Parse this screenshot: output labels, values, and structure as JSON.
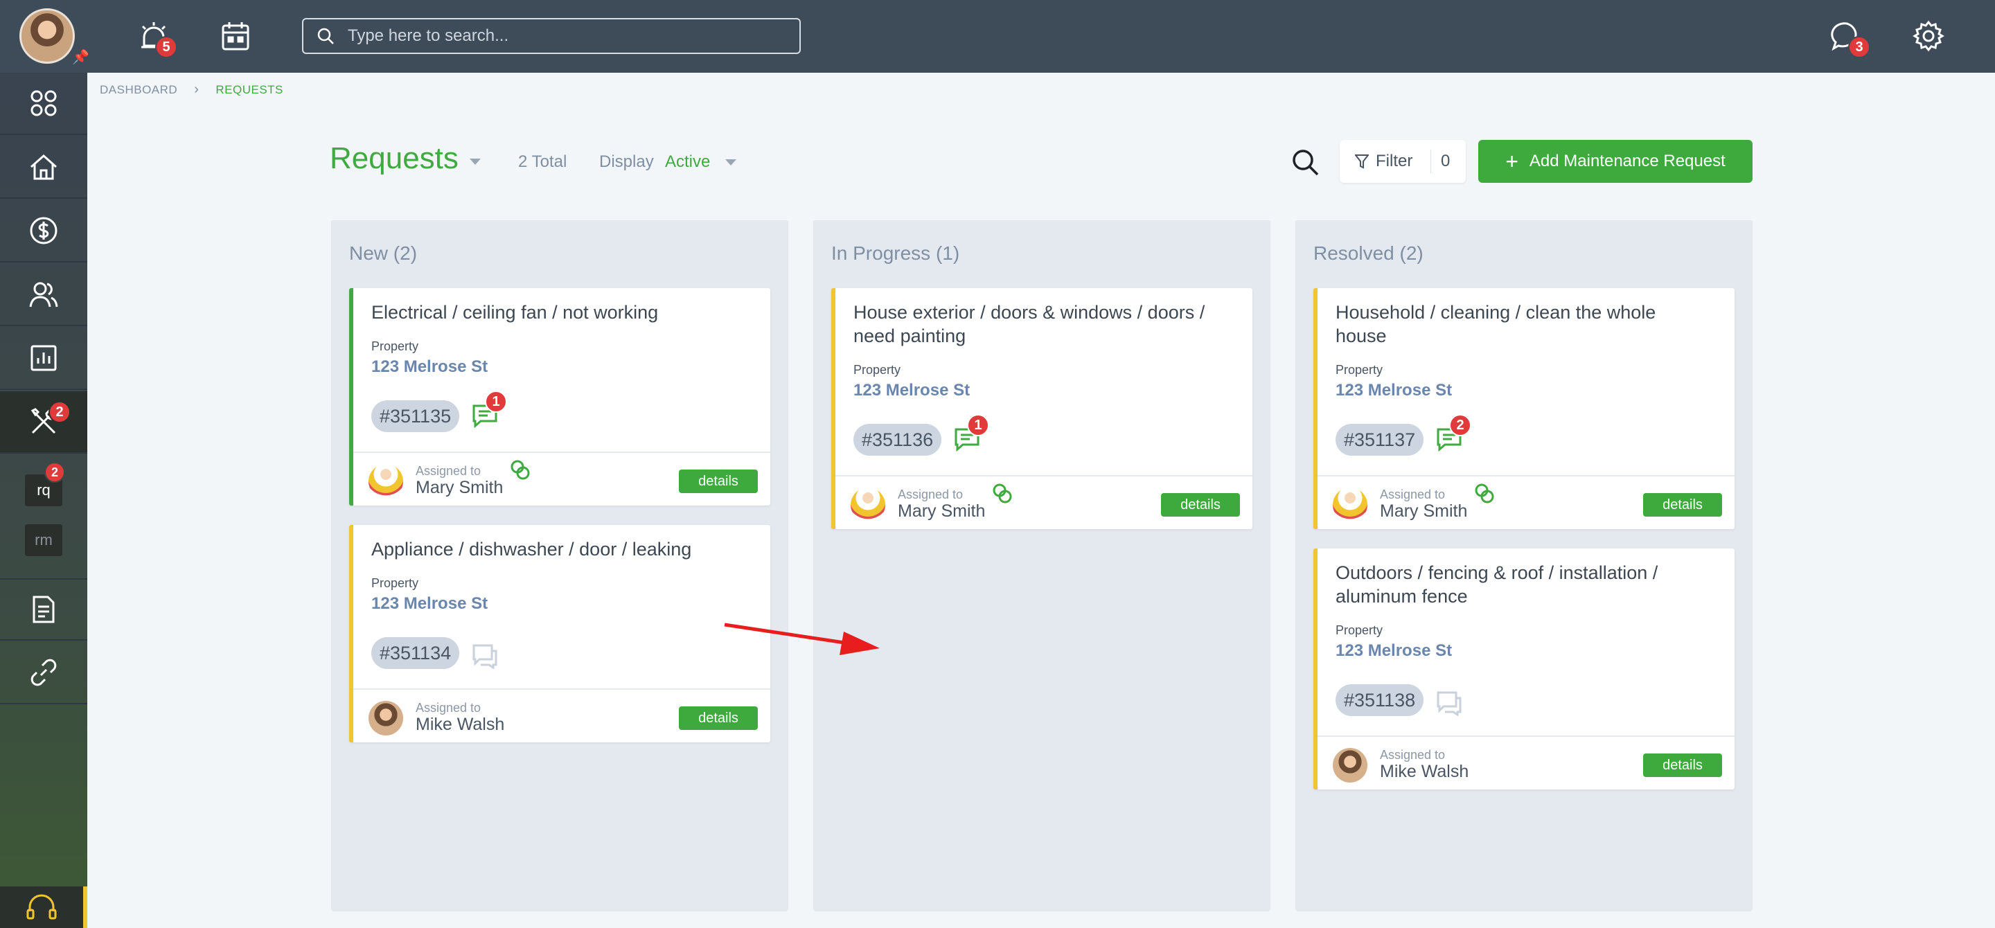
{
  "topbar": {
    "notifications_badge": "5",
    "search_placeholder": "Type here to search...",
    "messages_badge": "3"
  },
  "sidebar": {
    "items": [
      {
        "icon": "grid-icon"
      },
      {
        "icon": "home-icon"
      },
      {
        "icon": "dollar-icon"
      },
      {
        "icon": "users-icon"
      },
      {
        "icon": "chart-icon"
      },
      {
        "icon": "tools-icon",
        "badge": "2"
      },
      {
        "icon": "document-icon"
      },
      {
        "icon": "link-icon"
      }
    ],
    "sub_items": [
      {
        "label": "rq",
        "badge": "2"
      },
      {
        "label": "rm"
      }
    ],
    "help_icon": "headset-icon"
  },
  "breadcrumb": {
    "items": [
      "DASHBOARD",
      "REQUESTS"
    ]
  },
  "header": {
    "title": "Requests",
    "total": "2 Total",
    "display_label": "Display",
    "display_value": "Active",
    "filter_label": "Filter",
    "filter_count": "0",
    "add_button": "Add Maintenance Request"
  },
  "columns": [
    {
      "title": "New (2)",
      "cards": [
        {
          "title": "Electrical / ceiling fan / not working",
          "property_label": "Property",
          "property": "123 Melrose St",
          "id": "#351135",
          "comments": "1",
          "assigned_label": "Assigned to",
          "assignee": "Mary Smith",
          "details": "details",
          "accent": "#3faa3f"
        },
        {
          "title": "Appliance / dishwasher / door / leaking",
          "property_label": "Property",
          "property": "123 Melrose St",
          "id": "#351134",
          "comments": "",
          "assigned_label": "Assigned to",
          "assignee": "Mike Walsh",
          "details": "details",
          "accent": "#f2c530"
        }
      ]
    },
    {
      "title": "In Progress (1)",
      "cards": [
        {
          "title": "House exterior / doors & windows / doors / need painting",
          "property_label": "Property",
          "property": "123 Melrose St",
          "id": "#351136",
          "comments": "1",
          "assigned_label": "Assigned to",
          "assignee": "Mary Smith",
          "details": "details",
          "accent": "#f2c530"
        }
      ]
    },
    {
      "title": "Resolved (2)",
      "cards": [
        {
          "title": "Household / cleaning / clean the whole house",
          "property_label": "Property",
          "property": "123 Melrose St",
          "id": "#351137",
          "comments": "2",
          "assigned_label": "Assigned to",
          "assignee": "Mary Smith",
          "details": "details",
          "accent": "#f2c530"
        },
        {
          "title": "Outdoors / fencing & roof / installation / aluminum fence",
          "property_label": "Property",
          "property": "123 Melrose St",
          "id": "#351138",
          "comments": "",
          "assigned_label": "Assigned to",
          "assignee": "Mike Walsh",
          "details": "details",
          "accent": "#f2c530"
        }
      ]
    }
  ],
  "colors": {
    "brand_green": "#3faa3f",
    "topbar": "#3e4b59",
    "badge_red": "#e03a3a",
    "annotation_arrow": "#e81e1e"
  }
}
